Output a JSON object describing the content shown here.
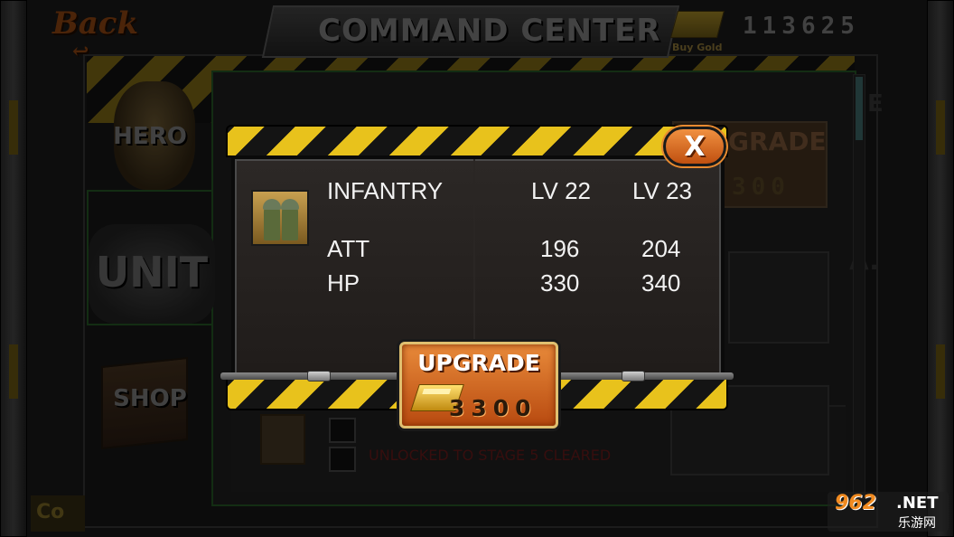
{
  "header": {
    "back_label": "Back",
    "title": "COMMAND CENTER",
    "buy_gold_label": "Buy Gold",
    "gold_amount": "113625"
  },
  "tabs": [
    {
      "label": "HERO"
    },
    {
      "label": "UNIT"
    },
    {
      "label": "SHOP"
    }
  ],
  "background": {
    "upgrade_label": "GRADE",
    "upgrade_cost": "300",
    "locked_text": "UNLOCKED TO STAGE 5 CLEARED",
    "corner_text": "Co",
    "right_letter_1": "E",
    "right_letter_2": "A."
  },
  "popup": {
    "close_label": "X",
    "unit_name": "INFANTRY",
    "level_current": "LV 22",
    "level_next": "LV 23",
    "stats": [
      {
        "label": "ATT",
        "current": "196",
        "next": "204"
      },
      {
        "label": "HP",
        "current": "330",
        "next": "340"
      }
    ],
    "upgrade_label": "UPGRADE",
    "upgrade_cost": "3300"
  },
  "watermark": {
    "number": "962",
    "suffix": ".NET",
    "subtitle": "乐游网"
  },
  "colors": {
    "hazard_yellow": "#e8c21c",
    "button_orange": "#e88a3a",
    "text_white": "#f2f2f2",
    "locked_red": "#5a1818"
  }
}
